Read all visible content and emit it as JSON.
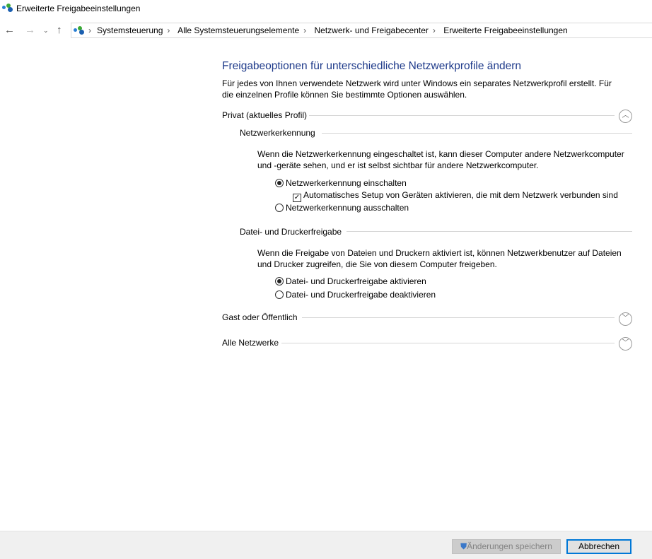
{
  "window": {
    "title": "Erweiterte Freigabeeinstellungen"
  },
  "breadcrumb": [
    "Systemsteuerung",
    "Alle Systemsteuerungselemente",
    "Netzwerk- und Freigabecenter",
    "Erweiterte Freigabeeinstellungen"
  ],
  "main": {
    "title": "Freigabeoptionen für unterschiedliche Netzwerkprofile ändern",
    "intro": "Für jedes von Ihnen verwendete Netzwerk wird unter Windows ein separates Netzwerkprofil erstellt. Für die einzelnen Profile können Sie bestimmte Optionen auswählen.",
    "profiles": {
      "private": {
        "label": "Privat (aktuelles Profil)",
        "expanded": true
      },
      "guest": {
        "label": "Gast oder Öffentlich",
        "expanded": false
      },
      "all": {
        "label": "Alle Netzwerke",
        "expanded": false
      }
    },
    "discovery": {
      "heading": "Netzwerkerkennung",
      "desc": "Wenn die Netzwerkerkennung eingeschaltet ist, kann dieser Computer andere Netzwerkcomputer und -geräte sehen, und er ist selbst sichtbar für andere Netzwerkcomputer.",
      "on": "Netzwerkerkennung einschalten",
      "auto": "Automatisches Setup von Geräten aktivieren, die mit dem Netzwerk verbunden sind",
      "off": "Netzwerkerkennung ausschalten",
      "selected": "on",
      "auto_checked": true
    },
    "sharing": {
      "heading": "Datei- und Druckerfreigabe",
      "desc": "Wenn die Freigabe von Dateien und Druckern aktiviert ist, können Netzwerkbenutzer auf Dateien und Drucker zugreifen, die Sie von diesem Computer freigeben.",
      "on": "Datei- und Druckerfreigabe aktivieren",
      "off": "Datei- und Druckerfreigabe deaktivieren",
      "selected": "on"
    }
  },
  "footer": {
    "save": "Änderungen speichern",
    "cancel": "Abbrechen"
  }
}
